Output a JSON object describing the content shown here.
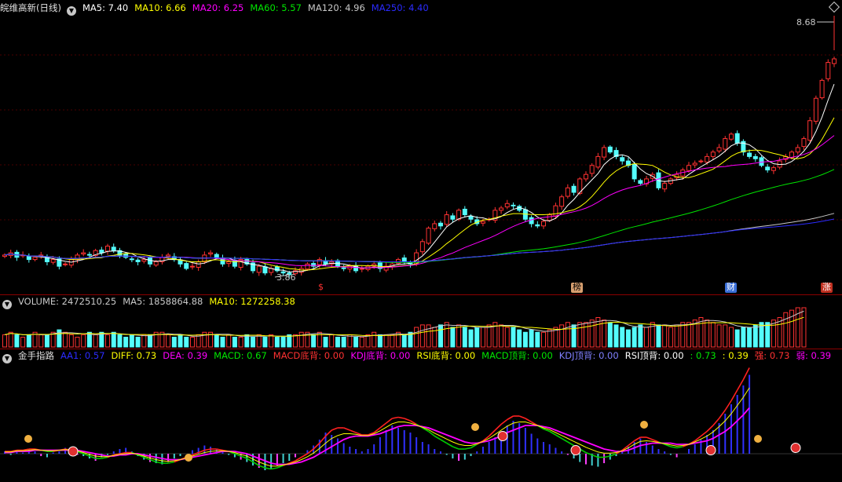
{
  "colors": {
    "up": "#ff3232",
    "down": "#54fcfc",
    "ma5": "#ffffff",
    "ma10": "#ffff00",
    "ma20": "#ff00ff",
    "ma60": "#00e600",
    "ma120": "#c8c8c8",
    "ma250": "#2b2bff",
    "grid": "#4a0000"
  },
  "main": {
    "title": "皖维高新(日线)",
    "indicators": [
      {
        "label": "MA5: 7.40",
        "color": "#ffffff"
      },
      {
        "label": "MA10: 6.66",
        "color": "#ffff00"
      },
      {
        "label": "MA20: 6.25",
        "color": "#ff00ff"
      },
      {
        "label": "MA60: 5.57",
        "color": "#00e600"
      },
      {
        "label": "MA120: 4.96",
        "color": "#c8c8c8"
      },
      {
        "label": "MA250: 4.40",
        "color": "#2b2bff"
      }
    ],
    "high_label": "8.68",
    "low_label": "3.86",
    "event_markers": [
      {
        "label": "$",
        "color": "#ff3232",
        "bg": "none"
      },
      {
        "label": "榜",
        "color": "#000",
        "bg": "#d8a070"
      },
      {
        "label": "财",
        "color": "#fff",
        "bg": "#3a6fd8"
      },
      {
        "label": "涨",
        "color": "#fff",
        "bg": "#c03020"
      }
    ]
  },
  "volume": {
    "indicators": [
      {
        "label": "VOLUME: 2472510.25",
        "color": "#c8c8c8"
      },
      {
        "label": "MA5: 1858864.88",
        "color": "#c8c8c8"
      },
      {
        "label": "MA10: 1272258.38",
        "color": "#ffff00"
      }
    ]
  },
  "indicator": {
    "title": "金手指路",
    "indicators": [
      {
        "label": "AA1: 0.57",
        "color": "#2b2bff"
      },
      {
        "label": "DIFF: 0.73",
        "color": "#ffff00"
      },
      {
        "label": "DEA: 0.39",
        "color": "#ff00ff"
      },
      {
        "label": "MACD: 0.67",
        "color": "#00e600"
      },
      {
        "label": "MACD底背: 0.00",
        "color": "#ff3232"
      },
      {
        "label": "KDJ底背: 0.00",
        "color": "#ff00ff"
      },
      {
        "label": "RSI底背: 0.00",
        "color": "#ffff00"
      },
      {
        "label": "MACD顶背: 0.00",
        "color": "#00e600"
      },
      {
        "label": "KDJ顶背: 0.00",
        "color": "#8080ff"
      },
      {
        "label": "RSI顶背: 0.00",
        "color": "#ffffff"
      },
      {
        "label": ": 0.73",
        "color": "#00e600"
      },
      {
        "label": ": 0.39",
        "color": "#ffff00"
      },
      {
        "label": "强: 0.73",
        "color": "#ff3232"
      },
      {
        "label": "弱: 0.39",
        "color": "#ff00ff"
      }
    ]
  },
  "chart_data": {
    "type": "candlestick",
    "price_range": [
      3.86,
      8.68
    ],
    "closes": [
      4.3,
      4.35,
      4.25,
      4.3,
      4.2,
      4.25,
      4.3,
      4.15,
      4.2,
      4.05,
      4.1,
      4.2,
      4.3,
      4.35,
      4.3,
      4.4,
      4.35,
      4.5,
      4.4,
      4.3,
      4.25,
      4.2,
      4.15,
      4.2,
      4.1,
      4.15,
      4.25,
      4.3,
      4.2,
      4.1,
      4.0,
      4.05,
      4.15,
      4.3,
      4.35,
      4.25,
      4.1,
      4.15,
      4.05,
      4.2,
      4.1,
      3.95,
      4.05,
      3.9,
      4.0,
      3.95,
      3.9,
      3.86,
      3.95,
      4.0,
      4.1,
      4.05,
      4.2,
      4.1,
      4.15,
      4.05,
      4.0,
      4.05,
      3.95,
      4.0,
      4.05,
      4.1,
      4.0,
      4.05,
      4.1,
      4.2,
      4.15,
      4.1,
      4.35,
      4.6,
      4.9,
      5.0,
      4.95,
      5.2,
      5.1,
      5.3,
      5.2,
      5.1,
      5.0,
      5.05,
      5.1,
      5.3,
      5.35,
      5.45,
      5.4,
      5.3,
      5.1,
      5.0,
      4.95,
      5.05,
      5.2,
      5.4,
      5.6,
      5.8,
      5.7,
      6.0,
      6.1,
      6.3,
      6.5,
      6.7,
      6.6,
      6.5,
      6.4,
      6.3,
      6.0,
      5.9,
      6.0,
      6.1,
      5.8,
      5.9,
      6.0,
      6.1,
      6.2,
      6.3,
      6.35,
      6.4,
      6.5,
      6.6,
      6.7,
      6.9,
      7.0,
      6.8,
      6.6,
      6.5,
      6.45,
      6.3,
      6.2,
      6.25,
      6.4,
      6.5,
      6.6,
      6.7,
      6.9,
      7.3,
      7.8,
      8.2,
      8.6,
      8.68
    ],
    "volumes": [
      5,
      6,
      5,
      4,
      5,
      6,
      5,
      5,
      6,
      7,
      6,
      5,
      4,
      5,
      6,
      5,
      6,
      5,
      6,
      5,
      4,
      5,
      4,
      5,
      5,
      6,
      6,
      5,
      4,
      5,
      4,
      4,
      5,
      6,
      6,
      5,
      4,
      5,
      4,
      4,
      5,
      4,
      5,
      4,
      5,
      4,
      4,
      5,
      5,
      6,
      6,
      5,
      6,
      4,
      5,
      4,
      4,
      5,
      4,
      4,
      5,
      6,
      5,
      5,
      5,
      6,
      5,
      6,
      8,
      9,
      9,
      8,
      9,
      10,
      8,
      9,
      8,
      7,
      8,
      8,
      9,
      10,
      9,
      8,
      8,
      7,
      6,
      7,
      6,
      6,
      7,
      8,
      9,
      10,
      9,
      10,
      10,
      11,
      12,
      11,
      10,
      9,
      8,
      7,
      8,
      9,
      8,
      10,
      9,
      9,
      8,
      9,
      10,
      10,
      11,
      12,
      11,
      10,
      9,
      9,
      8,
      7,
      8,
      8,
      9,
      10,
      10,
      11,
      12,
      14,
      15,
      16,
      16
    ],
    "macd": [
      0.02,
      -0.01,
      0.03,
      0.01,
      0.04,
      0.02,
      -0.02,
      -0.03,
      0.01,
      0.02,
      0.05,
      0.03,
      -0.01,
      -0.02,
      -0.04,
      -0.06,
      -0.03,
      -0.01,
      0.02,
      0.04,
      0.05,
      0.02,
      -0.02,
      -0.05,
      -0.07,
      -0.08,
      -0.09,
      -0.07,
      -0.04,
      -0.02,
      0.0,
      0.03,
      0.05,
      0.07,
      0.06,
      0.04,
      0.02,
      -0.01,
      -0.03,
      -0.05,
      -0.07,
      -0.1,
      -0.12,
      -0.14,
      -0.13,
      -0.1,
      -0.08,
      -0.06,
      -0.03,
      0.0,
      0.03,
      0.07,
      0.12,
      0.18,
      0.16,
      0.13,
      0.09,
      0.06,
      0.04,
      0.02,
      0.04,
      0.08,
      0.14,
      0.2,
      0.24,
      0.22,
      0.2,
      0.18,
      0.14,
      0.1,
      0.08,
      0.04,
      0.02,
      -0.01,
      -0.04,
      -0.06,
      -0.05,
      -0.02,
      0.02,
      0.06,
      0.1,
      0.14,
      0.19,
      0.24,
      0.28,
      0.26,
      0.22,
      0.17,
      0.13,
      0.1,
      0.08,
      0.05,
      0.02,
      -0.01,
      -0.04,
      -0.07,
      -0.09,
      -0.1,
      -0.11,
      -0.08,
      -0.05,
      -0.02,
      0.02,
      0.06,
      0.1,
      0.13,
      0.1,
      0.07,
      0.04,
      0.02,
      -0.01,
      -0.03,
      0.0,
      0.04,
      0.08,
      0.12,
      0.16,
      0.2,
      0.26,
      0.34,
      0.42,
      0.5,
      0.58,
      0.67
    ],
    "diff": [
      0.02,
      0.02,
      0.03,
      0.03,
      0.04,
      0.04,
      0.03,
      0.02,
      0.02,
      0.03,
      0.04,
      0.03,
      0.02,
      0.0,
      -0.02,
      -0.04,
      -0.04,
      -0.03,
      -0.01,
      0.0,
      0.01,
      0.01,
      -0.01,
      -0.03,
      -0.05,
      -0.07,
      -0.08,
      -0.08,
      -0.07,
      -0.05,
      -0.03,
      -0.01,
      0.01,
      0.03,
      0.04,
      0.04,
      0.03,
      0.02,
      0.0,
      -0.02,
      -0.04,
      -0.07,
      -0.1,
      -0.12,
      -0.13,
      -0.12,
      -0.1,
      -0.08,
      -0.06,
      -0.03,
      0.0,
      0.04,
      0.09,
      0.15,
      0.2,
      0.22,
      0.22,
      0.2,
      0.18,
      0.16,
      0.16,
      0.18,
      0.22,
      0.26,
      0.3,
      0.31,
      0.3,
      0.28,
      0.25,
      0.22,
      0.19,
      0.15,
      0.12,
      0.09,
      0.06,
      0.04,
      0.04,
      0.05,
      0.08,
      0.11,
      0.15,
      0.2,
      0.25,
      0.29,
      0.32,
      0.32,
      0.3,
      0.27,
      0.24,
      0.21,
      0.19,
      0.16,
      0.13,
      0.1,
      0.07,
      0.04,
      0.01,
      -0.01,
      -0.03,
      -0.03,
      -0.02,
      0.0,
      0.03,
      0.07,
      0.11,
      0.14,
      0.14,
      0.12,
      0.1,
      0.08,
      0.06,
      0.05,
      0.06,
      0.08,
      0.11,
      0.15,
      0.19,
      0.24,
      0.3,
      0.37,
      0.45,
      0.54,
      0.63,
      0.73
    ],
    "dea": [
      0.01,
      0.01,
      0.02,
      0.02,
      0.02,
      0.03,
      0.03,
      0.03,
      0.03,
      0.03,
      0.03,
      0.03,
      0.03,
      0.02,
      0.01,
      0.0,
      -0.01,
      -0.02,
      -0.02,
      -0.01,
      -0.01,
      0.0,
      0.0,
      -0.01,
      -0.02,
      -0.03,
      -0.04,
      -0.05,
      -0.05,
      -0.05,
      -0.04,
      -0.03,
      -0.02,
      -0.01,
      0.0,
      0.01,
      0.02,
      0.02,
      0.02,
      0.01,
      0.0,
      -0.02,
      -0.04,
      -0.06,
      -0.08,
      -0.09,
      -0.09,
      -0.09,
      -0.08,
      -0.07,
      -0.05,
      -0.03,
      0.0,
      0.03,
      0.06,
      0.09,
      0.12,
      0.14,
      0.15,
      0.15,
      0.15,
      0.16,
      0.17,
      0.19,
      0.21,
      0.23,
      0.24,
      0.24,
      0.24,
      0.23,
      0.22,
      0.2,
      0.18,
      0.16,
      0.14,
      0.12,
      0.1,
      0.09,
      0.09,
      0.1,
      0.11,
      0.13,
      0.15,
      0.18,
      0.2,
      0.22,
      0.24,
      0.24,
      0.24,
      0.23,
      0.22,
      0.2,
      0.18,
      0.16,
      0.14,
      0.12,
      0.1,
      0.08,
      0.06,
      0.04,
      0.03,
      0.02,
      0.02,
      0.03,
      0.05,
      0.07,
      0.08,
      0.09,
      0.09,
      0.09,
      0.09,
      0.08,
      0.08,
      0.08,
      0.09,
      0.1,
      0.11,
      0.13,
      0.16,
      0.19,
      0.23,
      0.28,
      0.33,
      0.39
    ]
  }
}
